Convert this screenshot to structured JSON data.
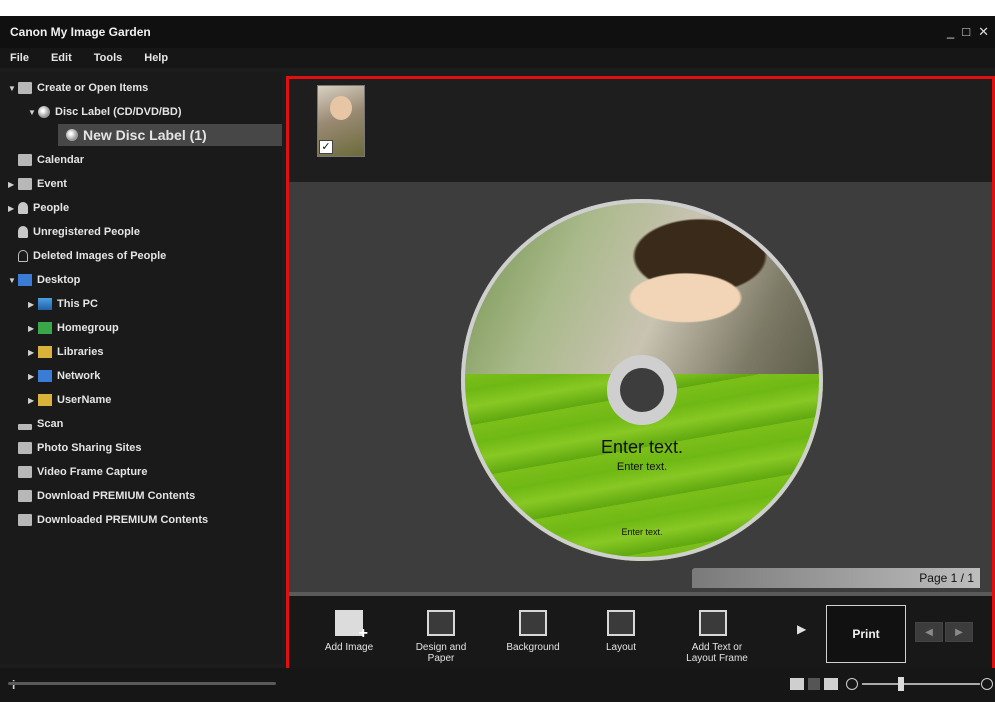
{
  "app": {
    "title": "Canon My Image Garden",
    "window_controls": [
      "_",
      "□",
      "✕"
    ]
  },
  "menu": [
    "File",
    "Edit",
    "Tools",
    "Help"
  ],
  "sidebar": {
    "items": [
      {
        "label": "Create or Open Items",
        "icon": "create-icon",
        "level": 0,
        "expanded": true
      },
      {
        "label": "Disc Label (CD/DVD/BD)",
        "icon": "disc-icon",
        "level": 1,
        "expanded": true
      },
      {
        "label": "New Disc Label (1)",
        "icon": "disc-icon",
        "level": 2,
        "selected": true
      },
      {
        "label": "Calendar",
        "icon": "calendar-icon",
        "level": 0
      },
      {
        "label": "Event",
        "icon": "event-icon",
        "level": 0,
        "collapsed": true
      },
      {
        "label": "People",
        "icon": "people-icon",
        "level": 0,
        "collapsed": true
      },
      {
        "label": "Unregistered People",
        "icon": "person-icon",
        "level": 0
      },
      {
        "label": "Deleted Images of People",
        "icon": "person-outline-icon",
        "level": 0
      },
      {
        "label": "Desktop",
        "icon": "desktop-icon",
        "level": 0,
        "expanded": true
      },
      {
        "label": "This PC",
        "icon": "pc-icon",
        "level": 1,
        "collapsed": true
      },
      {
        "label": "Homegroup",
        "icon": "homegroup-icon",
        "level": 1,
        "collapsed": true
      },
      {
        "label": "Libraries",
        "icon": "libraries-icon",
        "level": 1,
        "collapsed": true
      },
      {
        "label": "Network",
        "icon": "network-icon",
        "level": 1,
        "collapsed": true
      },
      {
        "label": "UserName",
        "icon": "user-folder-icon",
        "level": 1,
        "collapsed": true
      },
      {
        "label": "Scan",
        "icon": "scan-icon",
        "level": 0
      },
      {
        "label": "Photo Sharing Sites",
        "icon": "photo-sharing-icon",
        "level": 0
      },
      {
        "label": "Video Frame Capture",
        "icon": "video-capture-icon",
        "level": 0
      },
      {
        "label": "Download PREMIUM Contents",
        "icon": "download-icon",
        "level": 0
      },
      {
        "label": "Downloaded PREMIUM Contents",
        "icon": "folder-icon",
        "level": 0
      }
    ]
  },
  "editor": {
    "disc_text": {
      "title": "Enter text.",
      "subtitle": "Enter text.",
      "footer": "Enter text."
    },
    "page_label": "Page 1 / 1"
  },
  "toolbar": {
    "add_image": "Add Image",
    "design_and_paper": "Design and Paper",
    "background": "Background",
    "layout": "Layout",
    "add_text_or_layout_frame": "Add Text or Layout Frame",
    "print": "Print"
  },
  "status": {
    "info": "i"
  },
  "colors": {
    "selection_border": "#e01010",
    "disc_green": "#7cbf1a"
  }
}
